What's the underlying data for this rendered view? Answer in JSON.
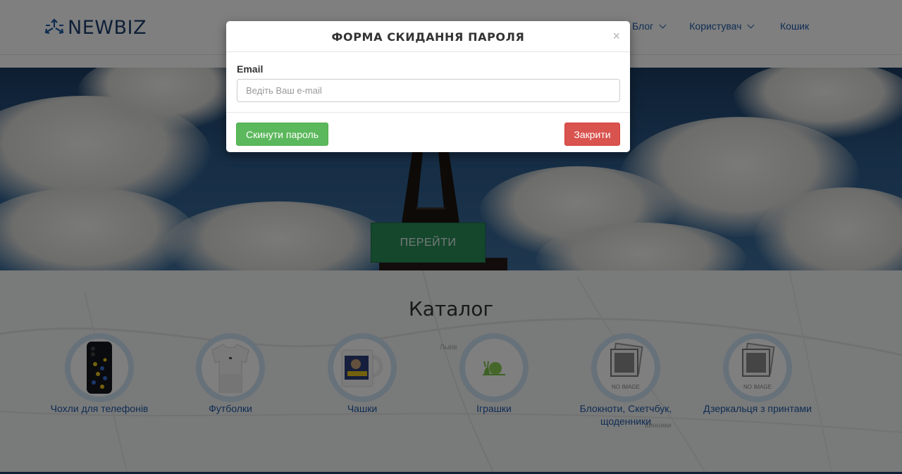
{
  "header": {
    "brand": "NEWBIZ",
    "nav": [
      {
        "label": "Блог"
      },
      {
        "label": "Користувач"
      }
    ],
    "cart_label": "Кошик"
  },
  "hero": {
    "button_label": "ПЕРЕЙТИ"
  },
  "catalog": {
    "title": "Каталог",
    "map_labels": [
      "Львів",
      "винники"
    ],
    "items": [
      {
        "label": "Чохли для телефонів",
        "icon": "phone-case-image"
      },
      {
        "label": "Футболки",
        "icon": "tshirt-image"
      },
      {
        "label": "Чашки",
        "icon": "mug-image"
      },
      {
        "label": "Іграшки",
        "icon": "snail-toy-image"
      },
      {
        "label": "Блокноти, Скетчбук, щоденники",
        "icon": "no-image-placeholder",
        "placeholder_text": "NO IMAGE"
      },
      {
        "label": "Дзеркальця з принтами",
        "icon": "no-image-placeholder",
        "placeholder_text": "NO IMAGE"
      }
    ]
  },
  "modal": {
    "title": "ФОРМА СКИДАННЯ ПАРОЛЯ",
    "close_symbol": "×",
    "email_label": "Email",
    "email_placeholder": "Ведіть Ваш e-mail",
    "email_value": "",
    "reset_button": "Скинути пароль",
    "close_button": "Закрити"
  },
  "colors": {
    "brand_dark": "#1d3e6e",
    "link": "#1e5aa6",
    "success": "#5cb85c",
    "danger": "#d9534f",
    "hero_button": "#2a8f5a"
  }
}
